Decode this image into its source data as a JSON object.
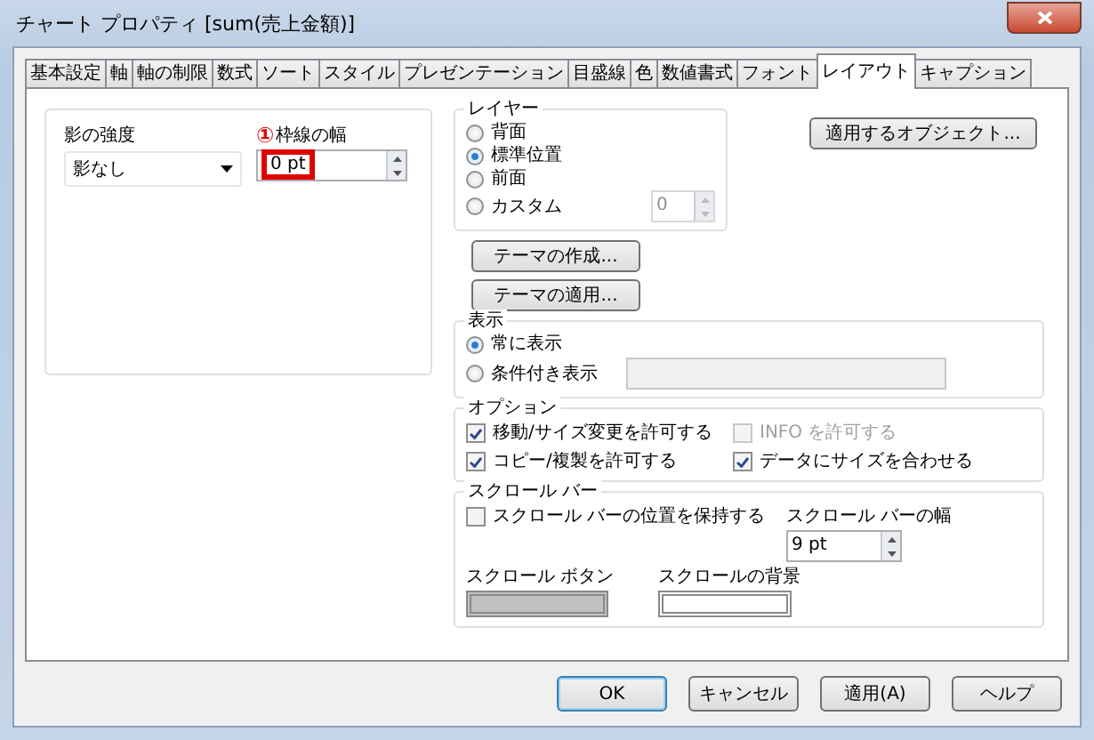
{
  "window": {
    "title": "チャート プロパティ [sum(売上金額)]"
  },
  "tabs": [
    {
      "label": "基本設定",
      "selected": false
    },
    {
      "label": "軸",
      "selected": false
    },
    {
      "label": "軸の制限",
      "selected": false
    },
    {
      "label": "数式",
      "selected": false
    },
    {
      "label": "ソート",
      "selected": false
    },
    {
      "label": "スタイル",
      "selected": false
    },
    {
      "label": "プレゼンテーション",
      "selected": false
    },
    {
      "label": "目盛線",
      "selected": false
    },
    {
      "label": "色",
      "selected": false
    },
    {
      "label": "数値書式",
      "selected": false
    },
    {
      "label": "フォント",
      "selected": false
    },
    {
      "label": "レイアウト",
      "selected": true
    },
    {
      "label": "キャプション",
      "selected": false
    }
  ],
  "shadow": {
    "label": "影の強度",
    "value": "影なし"
  },
  "border_width": {
    "marker": "①",
    "label": "枠線の幅",
    "value": "0 pt",
    "highlighted": true
  },
  "layer": {
    "title": "レイヤー",
    "options": [
      {
        "label": "背面",
        "selected": false
      },
      {
        "label": "標準位置",
        "selected": true
      },
      {
        "label": "前面",
        "selected": false
      },
      {
        "label": "カスタム",
        "selected": false
      }
    ],
    "custom_value": "0"
  },
  "apply_objects_button": "適用するオブジェクト...",
  "theme_buttons": [
    "テーマの作成...",
    "テーマの適用..."
  ],
  "display": {
    "title": "表示",
    "options": [
      {
        "label": "常に表示",
        "selected": true
      },
      {
        "label": "条件付き表示",
        "selected": false
      }
    ]
  },
  "options": {
    "title": "オプション",
    "items": [
      {
        "label": "移動/サイズ変更を許可する",
        "checked": true,
        "disabled": false
      },
      {
        "label": "INFO を許可する",
        "checked": false,
        "disabled": true
      },
      {
        "label": "コピー/複製を許可する",
        "checked": true,
        "disabled": false
      },
      {
        "label": "データにサイズを合わせる",
        "checked": true,
        "disabled": false
      }
    ]
  },
  "scrollbar": {
    "title": "スクロール バー",
    "keep_position": {
      "label": "スクロール バーの位置を保持する",
      "checked": false
    },
    "width": {
      "label": "スクロール バーの幅",
      "value": "9 pt"
    },
    "swatches": [
      {
        "label": "スクロール ボタン",
        "color": "#c0c0c0"
      },
      {
        "label": "スクロールの背景",
        "color": "#ffffff"
      }
    ]
  },
  "buttons": [
    {
      "label": "OK",
      "default": true
    },
    {
      "label": "キャンセル",
      "default": false
    },
    {
      "label": "適用(A)",
      "default": false
    },
    {
      "label": "ヘルプ",
      "default": false
    }
  ]
}
